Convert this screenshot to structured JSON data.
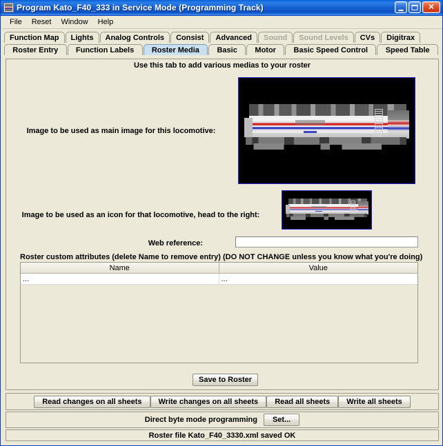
{
  "window": {
    "title": "Program Kato_F40_333 in Service Mode (Programming Track)",
    "icon": "locomotive-icon",
    "buttons": {
      "minimize": "minimize-icon",
      "maximize": "maximize-icon",
      "close": "close-icon"
    }
  },
  "menubar": {
    "items": [
      {
        "label": "File"
      },
      {
        "label": "Reset"
      },
      {
        "label": "Window"
      },
      {
        "label": "Help"
      }
    ]
  },
  "tabs": {
    "row1": [
      {
        "label": "Function Map",
        "selected": false,
        "disabled": false
      },
      {
        "label": "Lights",
        "selected": false,
        "disabled": false
      },
      {
        "label": "Analog Controls",
        "selected": false,
        "disabled": false
      },
      {
        "label": "Consist",
        "selected": false,
        "disabled": false
      },
      {
        "label": "Advanced",
        "selected": false,
        "disabled": false
      },
      {
        "label": "Sound",
        "selected": false,
        "disabled": true
      },
      {
        "label": "Sound Levels",
        "selected": false,
        "disabled": true
      },
      {
        "label": "CVs",
        "selected": false,
        "disabled": false
      },
      {
        "label": "Digitrax",
        "selected": false,
        "disabled": false
      }
    ],
    "row2": [
      {
        "label": "Roster Entry",
        "selected": false,
        "disabled": false
      },
      {
        "label": "Function Labels",
        "selected": false,
        "disabled": false
      },
      {
        "label": "Roster Media",
        "selected": true,
        "disabled": false
      },
      {
        "label": "Basic",
        "selected": false,
        "disabled": false
      },
      {
        "label": "Motor",
        "selected": false,
        "disabled": false
      },
      {
        "label": "Basic Speed Control",
        "selected": false,
        "disabled": false
      },
      {
        "label": "Speed Table",
        "selected": false,
        "disabled": false
      }
    ]
  },
  "main": {
    "hint": "Use this tab to add various medias to your roster",
    "main_image_label": "Image to be used as main image for this locomotive:",
    "icon_image_label": "Image to be used as an icon for that locomotive, head to the right:",
    "main_image_alt": "locomotive-main-image",
    "icon_image_alt": "locomotive-icon-image",
    "web_reference": {
      "label": "Web reference:",
      "value": "",
      "placeholder": ""
    },
    "attributes": {
      "caption": "Roster custom attributes (delete Name to remove entry) (DO NOT CHANGE unless you know what you're doing)",
      "columns": [
        "Name",
        "Value"
      ],
      "rows": [
        {
          "name": "...",
          "value": "..."
        }
      ]
    },
    "save_button": "Save to Roster"
  },
  "bottom_bar": {
    "buttons": [
      {
        "label": "Read changes on all sheets"
      },
      {
        "label": "Write changes on all sheets"
      },
      {
        "label": "Read all sheets"
      },
      {
        "label": "Write all sheets"
      }
    ]
  },
  "mode_bar": {
    "label": "Direct byte mode programming",
    "set_button": "Set..."
  },
  "status_bar": {
    "text": "Roster file Kato_F40_3330.xml saved OK"
  },
  "colors": {
    "title_blue": "#1560d0",
    "selected_tab": "#c9dff2",
    "panel": "#ece9d8",
    "image_border": "#2222cc"
  }
}
